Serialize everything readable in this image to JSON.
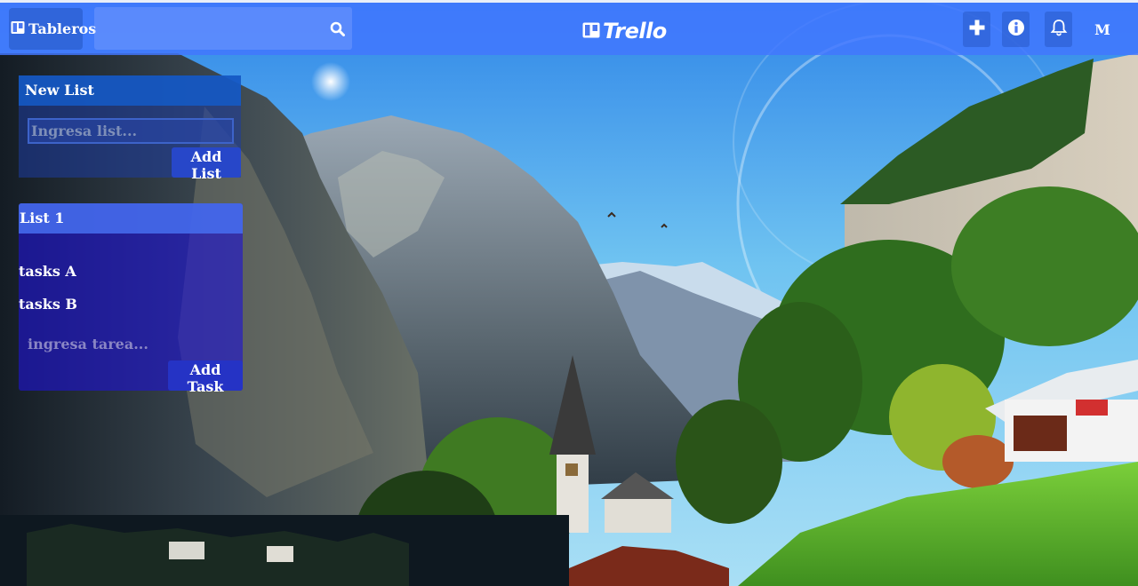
{
  "colors": {
    "navbar": "#4276ff",
    "accent_button": "#2747c9",
    "list_body": "#1e14d2",
    "text": "#ffffff"
  },
  "navbar": {
    "boards_label": "Tableros",
    "boards_icon": "board-icon",
    "search": {
      "value": "",
      "placeholder": "",
      "icon": "search-icon"
    },
    "logo_text": "Trello",
    "logo_icon": "trello-board-icon",
    "actions": [
      {
        "name": "add-icon"
      },
      {
        "name": "info-icon"
      },
      {
        "name": "bell-icon"
      }
    ],
    "avatar_initial": "M"
  },
  "new_list": {
    "title": "New List",
    "input_placeholder": "Ingresa list...",
    "input_value": "",
    "button_label": "Add List"
  },
  "lists": [
    {
      "title": "List 1",
      "tasks": [
        "tasks A",
        "tasks B"
      ],
      "task_input_placeholder": "ingresa tarea...",
      "button_label": "Add Task"
    }
  ]
}
